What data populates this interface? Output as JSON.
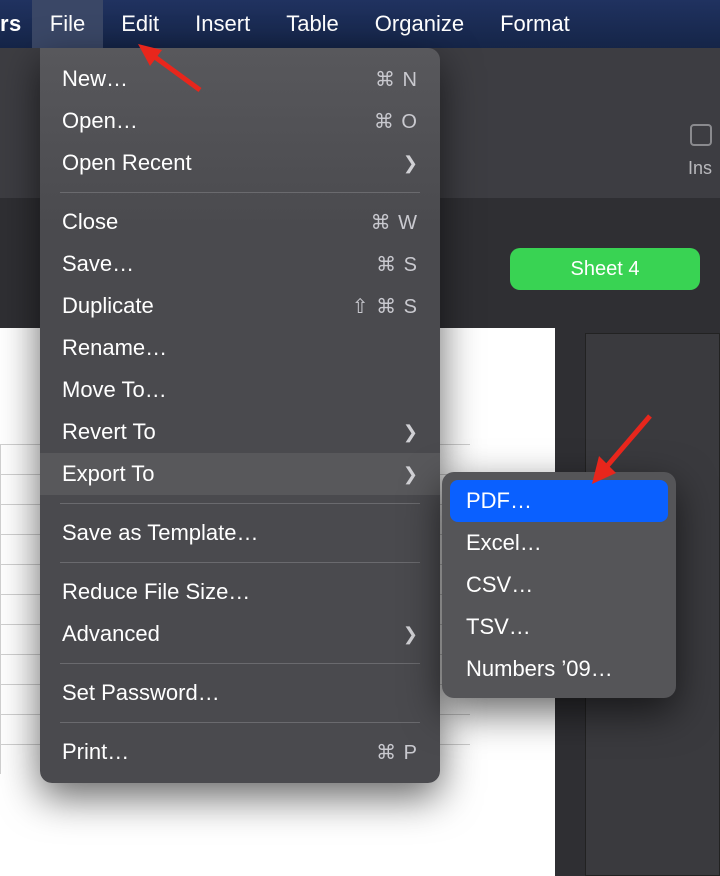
{
  "menubar": {
    "appname_suffix": "rs",
    "items": [
      "File",
      "Edit",
      "Insert",
      "Table",
      "Organize",
      "Format"
    ],
    "active_index": 0
  },
  "background": {
    "insert_label": "Ins",
    "sheet_tab_label": "Sheet 4"
  },
  "file_menu": {
    "groups": [
      [
        {
          "label": "New…",
          "shortcut": "⌘ N"
        },
        {
          "label": "Open…",
          "shortcut": "⌘ O"
        },
        {
          "label": "Open Recent",
          "submenu": true
        }
      ],
      [
        {
          "label": "Close",
          "shortcut": "⌘ W"
        },
        {
          "label": "Save…",
          "shortcut": "⌘ S"
        },
        {
          "label": "Duplicate",
          "shortcut": "⇧ ⌘ S"
        },
        {
          "label": "Rename…"
        },
        {
          "label": "Move To…"
        },
        {
          "label": "Revert To",
          "submenu": true
        },
        {
          "label": "Export To",
          "submenu": true,
          "hover": true
        }
      ],
      [
        {
          "label": "Save as Template…"
        }
      ],
      [
        {
          "label": "Reduce File Size…"
        },
        {
          "label": "Advanced",
          "submenu": true
        }
      ],
      [
        {
          "label": "Set Password…"
        }
      ],
      [
        {
          "label": "Print…",
          "shortcut": "⌘ P"
        }
      ]
    ]
  },
  "export_submenu": {
    "items": [
      "PDF…",
      "Excel…",
      "CSV…",
      "TSV…",
      "Numbers ’09…"
    ],
    "highlight_index": 0
  }
}
